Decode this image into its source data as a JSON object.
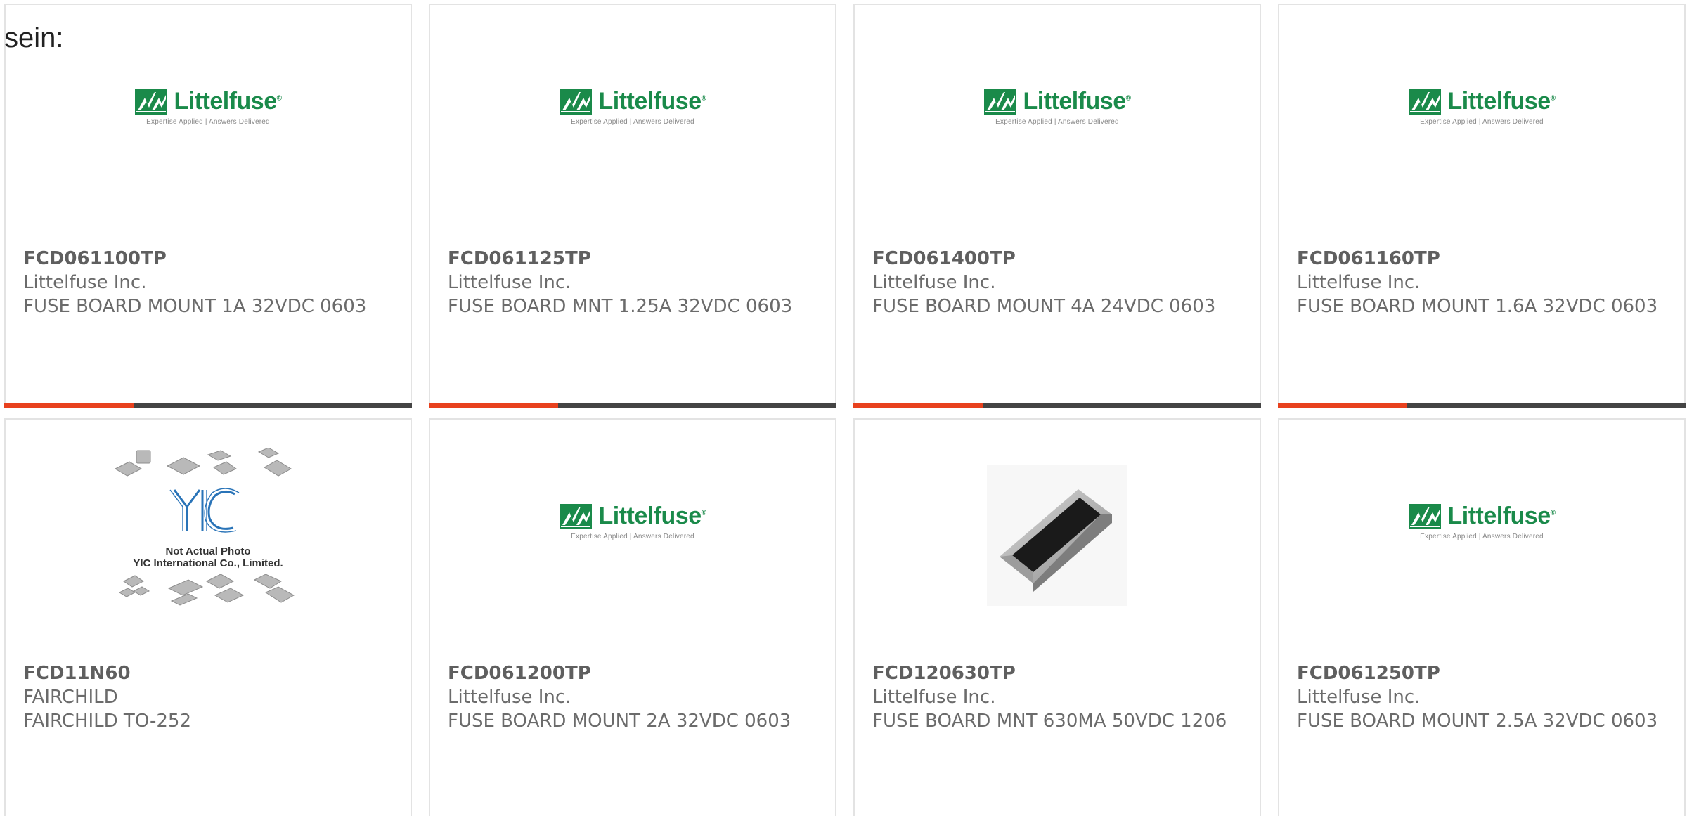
{
  "page": {
    "lead_text": "sein:"
  },
  "colors": {
    "accent_bar": "#e8411e",
    "dark_bar": "#444444",
    "littelfuse_green": "#1a8a4a",
    "yic_blue": "#2a74b8"
  },
  "products": [
    {
      "part_number": "FCD061100TP",
      "manufacturer": "Littelfuse Inc.",
      "description": "FUSE BOARD MOUNT 1A 32VDC 0603",
      "image": "littelfuse-logo"
    },
    {
      "part_number": "FCD061125TP",
      "manufacturer": "Littelfuse Inc.",
      "description": "FUSE BOARD MNT 1.25A 32VDC 0603",
      "image": "littelfuse-logo"
    },
    {
      "part_number": "FCD061400TP",
      "manufacturer": "Littelfuse Inc.",
      "description": "FUSE BOARD MOUNT 4A 24VDC 0603",
      "image": "littelfuse-logo"
    },
    {
      "part_number": "FCD061160TP",
      "manufacturer": "Littelfuse Inc.",
      "description": "FUSE BOARD MOUNT 1.6A 32VDC 0603",
      "image": "littelfuse-logo"
    },
    {
      "part_number": "FCD11N60",
      "manufacturer": "FAIRCHILD",
      "description": "FAIRCHILD TO-252",
      "image": "yic-placeholder"
    },
    {
      "part_number": "FCD061200TP",
      "manufacturer": "Littelfuse Inc.",
      "description": "FUSE BOARD MOUNT 2A 32VDC 0603",
      "image": "littelfuse-logo"
    },
    {
      "part_number": "FCD120630TP",
      "manufacturer": "Littelfuse Inc.",
      "description": "FUSE BOARD MNT 630MA 50VDC 1206",
      "image": "smd-chip-photo"
    },
    {
      "part_number": "FCD061250TP",
      "manufacturer": "Littelfuse Inc.",
      "description": "FUSE BOARD MOUNT 2.5A 32VDC 0603",
      "image": "littelfuse-logo"
    }
  ],
  "logos": {
    "littelfuse_word": "Littelfuse",
    "littelfuse_reg": "®",
    "littelfuse_tagline": "Expertise Applied | Answers Delivered",
    "yic_mark": "YIC",
    "yic_note_line1": "Not Actual Photo",
    "yic_note_line2": "YIC International Co., Limited."
  }
}
